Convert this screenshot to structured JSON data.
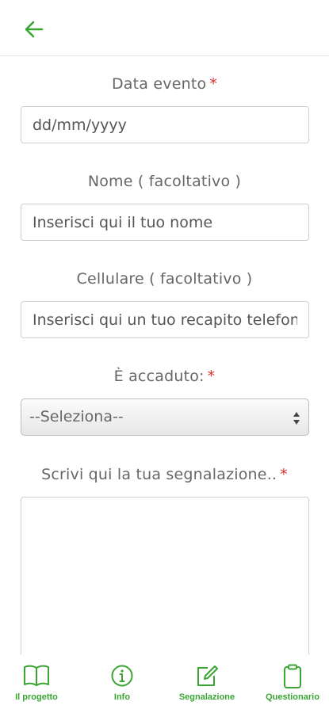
{
  "header": {
    "back_icon": "arrow-left-icon"
  },
  "form": {
    "date": {
      "label": "Data evento",
      "required_mark": "*",
      "placeholder": "dd/mm/yyyy"
    },
    "name": {
      "label": "Nome ( facoltativo )",
      "placeholder": "Inserisci qui il tuo nome"
    },
    "phone": {
      "label": "Cellulare ( facoltativo )",
      "placeholder": "Inserisci qui un tuo recapito telefonico"
    },
    "event": {
      "label": "È accaduto:",
      "required_mark": "*",
      "selected": "--Seleziona--"
    },
    "report": {
      "label": "Scrivi qui la tua segnalazione..",
      "required_mark": "*"
    }
  },
  "tabs": [
    {
      "label": "Il progetto",
      "icon": "book-icon"
    },
    {
      "label": "Info",
      "icon": "info-icon"
    },
    {
      "label": "Segnalazione",
      "icon": "edit-icon"
    },
    {
      "label": "Questionario",
      "icon": "clipboard-icon"
    }
  ],
  "colors": {
    "accent": "#3aa533",
    "required": "#d9302b"
  }
}
